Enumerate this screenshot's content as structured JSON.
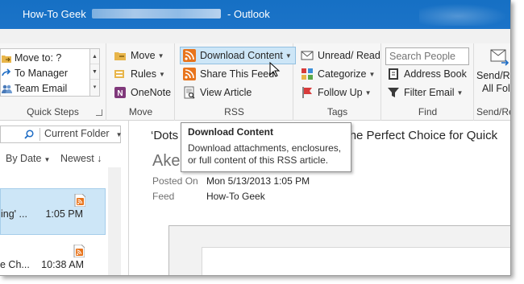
{
  "window": {
    "app_name": "How-To Geek",
    "separator": "-",
    "app_suffix": "Outlook"
  },
  "ribbon": {
    "quick_steps": {
      "items": [
        "Move to: ?",
        "To Manager",
        "Team Email"
      ],
      "label": "Quick Steps"
    },
    "move": {
      "move_label": "Move",
      "rules_label": "Rules",
      "onenote_label": "OneNote",
      "label": "Move"
    },
    "rss": {
      "download_label": "Download Content",
      "share_label": "Share This Feed",
      "view_label": "View Article",
      "label": "RSS"
    },
    "tags": {
      "unread_label": "Unread/ Read",
      "categorize_label": "Categorize",
      "followup_label": "Follow Up",
      "label": "Tags"
    },
    "find": {
      "search_placeholder": "Search People",
      "address_book_label": "Address Book",
      "filter_label": "Filter Email",
      "label": "Find"
    },
    "send_receive": {
      "line1": "Send/Re",
      "line2": "All Fol",
      "label": "Send/Re"
    }
  },
  "tooltip": {
    "title": "Download Content",
    "line1": "Download attachments, enclosures,",
    "line2": "or full content of this RSS article."
  },
  "mail_list": {
    "scope": "Current Folder",
    "sort_by": "By Date",
    "sort_order": "Newest",
    "sort_arrow": "↓",
    "items": [
      {
        "snippet": "ing' ...",
        "time": "1:05 PM"
      },
      {
        "snippet": "e Ch...",
        "time": "10:38 AM"
      }
    ]
  },
  "reading_pane": {
    "subject_start": "‘Dots",
    "subject_end": "the Perfect Choice for Quick",
    "sender_partial": "Ake",
    "posted_on_label": "Posted On",
    "posted_on_value": "Mon 5/13/2013 1:05 PM",
    "feed_label": "Feed",
    "feed_value": "How-To Geek"
  },
  "colors": {
    "titlebar": "#1670c4",
    "ribbon_bg": "#f6f6f6",
    "highlight": "#cde6f7",
    "rss_orange": "#e8741c"
  }
}
